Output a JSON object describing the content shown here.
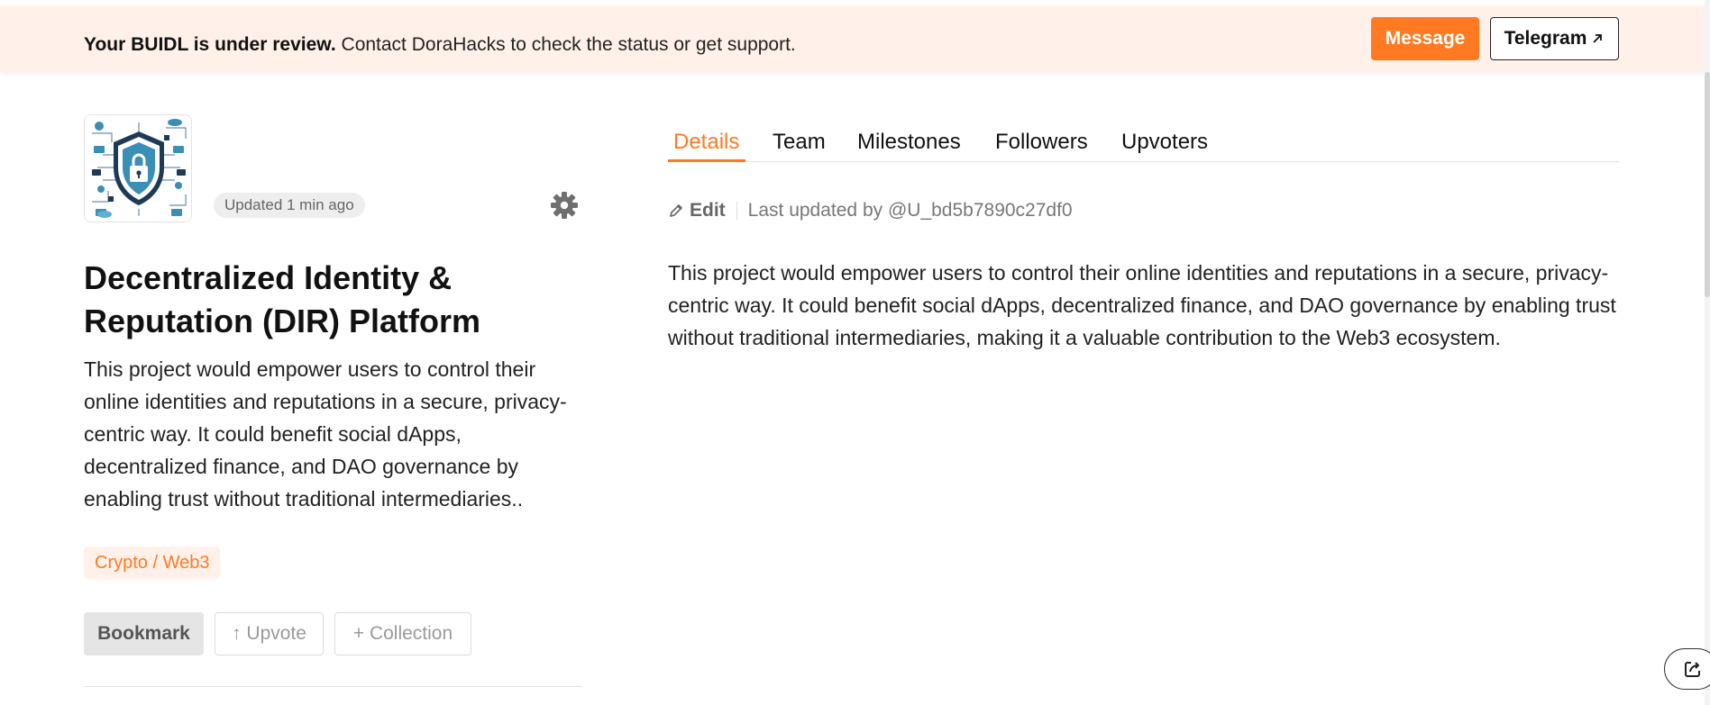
{
  "banner": {
    "bold_text": "Your BUIDL is under review.",
    "text": " Contact DoraHacks to check the status or get support.",
    "message_label": "Message",
    "telegram_label": "Telegram",
    "telegram_icon": "external-arrow-icon"
  },
  "project": {
    "updated_badge": "Updated 1 min ago",
    "title": "Decentralized Identity & Reputation (DIR) Platform",
    "short_description": "This project would empower users to control their online identities and reputations in a secure, privacy-centric way. It could benefit social dApps, decentralized finance, and DAO governance by enabling trust without traditional intermediaries..",
    "tag": "Crypto / Web3",
    "actions": {
      "bookmark": "Bookmark",
      "upvote": "↑ Upvote",
      "collection": "+ Collection"
    }
  },
  "tabs": [
    {
      "label": "Details",
      "active": true
    },
    {
      "label": "Team",
      "active": false
    },
    {
      "label": "Milestones",
      "active": false
    },
    {
      "label": "Followers",
      "active": false
    },
    {
      "label": "Upvoters",
      "active": false
    }
  ],
  "details": {
    "edit_label": "Edit",
    "last_updated": "Last updated by @U_bd5b7890c27df0",
    "body": "This project would empower users to control their online identities and reputations in a secure, privacy-centric way. It could benefit social dApps, decentralized finance, and DAO governance by enabling trust without traditional intermediaries, making it a valuable contribution to the Web3 ecosystem."
  },
  "colors": {
    "accent": "#ff7a21",
    "banner_bg": "#fff1ea",
    "tag_bg": "#fff1ea"
  },
  "icons": [
    "gear-icon",
    "pencil-icon",
    "share-icon",
    "shield-lock-logo"
  ]
}
